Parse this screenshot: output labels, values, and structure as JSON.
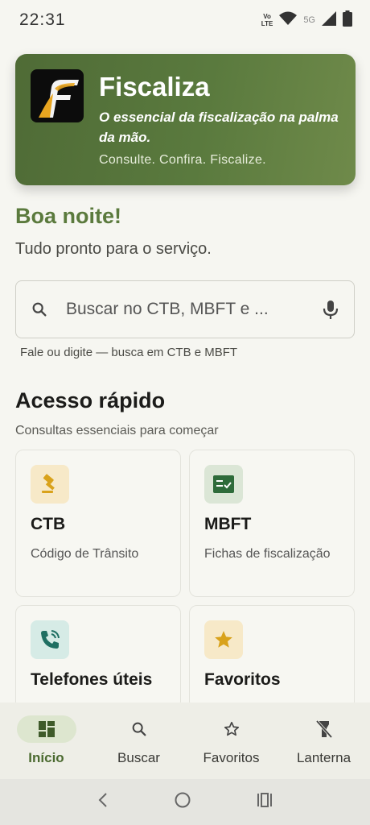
{
  "status_bar": {
    "time": "22:31",
    "network_tech": "5G",
    "volte_top": "Vo",
    "volte_bottom": "LTE"
  },
  "hero": {
    "title": "Fiscaliza",
    "tagline": "O essencial da fiscalização na palma da mão.",
    "motto": "Consulte. Confira. Fiscalize."
  },
  "greeting": {
    "title": "Boa noite!",
    "subtitle": "Tudo pronto para o serviço."
  },
  "search": {
    "placeholder": "Buscar no CTB, MBFT e ...",
    "helper": "Fale ou digite — busca em CTB e MBFT"
  },
  "quick_access": {
    "title": "Acesso rápido",
    "subtitle": "Consultas essenciais para começar",
    "cards": [
      {
        "title": "CTB",
        "description": "Código de Trânsito",
        "icon": "gavel-icon"
      },
      {
        "title": "MBFT",
        "description": "Fichas de fiscalização",
        "icon": "checklist-icon"
      },
      {
        "title": "Telefones úteis",
        "description": "",
        "icon": "phone-icon"
      },
      {
        "title": "Favoritos",
        "description": "",
        "icon": "star-icon"
      }
    ]
  },
  "bottom_nav": {
    "items": [
      {
        "label": "Início",
        "icon": "dashboard-icon",
        "active": true
      },
      {
        "label": "Buscar",
        "icon": "search-icon",
        "active": false
      },
      {
        "label": "Favoritos",
        "icon": "star-outline-icon",
        "active": false
      },
      {
        "label": "Lanterna",
        "icon": "flashlight-off-icon",
        "active": false
      }
    ]
  },
  "colors": {
    "accent": "#5b7a3d",
    "hero_bg": "#587840",
    "background": "#f6f6f1",
    "ctb_icon_bg": "#f7e9c8",
    "ctb_icon": "#d9a21b",
    "mbft_icon_bg": "#dbe6d6",
    "mbft_icon": "#2e6b3a",
    "phone_icon_bg": "#d6ebe6",
    "phone_icon": "#1f6f62",
    "fav_icon_bg": "#f7e9c8",
    "fav_icon": "#d9a21b"
  }
}
